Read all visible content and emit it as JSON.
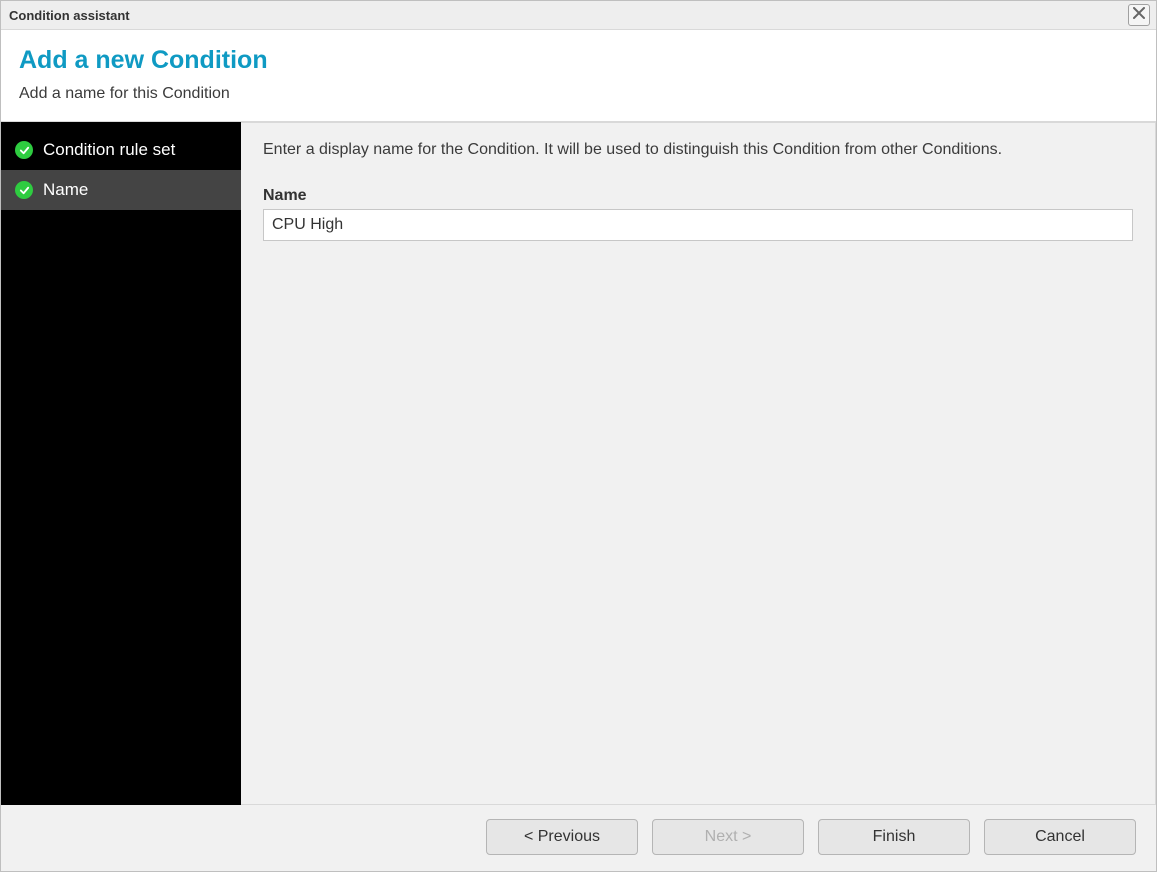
{
  "window": {
    "title": "Condition assistant"
  },
  "header": {
    "title": "Add a new Condition",
    "subtitle": "Add a name for this Condition"
  },
  "sidebar": {
    "items": [
      {
        "label": "Condition rule set",
        "completed": true,
        "active": false
      },
      {
        "label": "Name",
        "completed": true,
        "active": true
      }
    ]
  },
  "content": {
    "instruction": "Enter a display name for the Condition. It will be used to distinguish this Condition from other Conditions.",
    "name_label": "Name",
    "name_value": "CPU High"
  },
  "footer": {
    "previous": "< Previous",
    "next": "Next >",
    "finish": "Finish",
    "cancel": "Cancel"
  }
}
